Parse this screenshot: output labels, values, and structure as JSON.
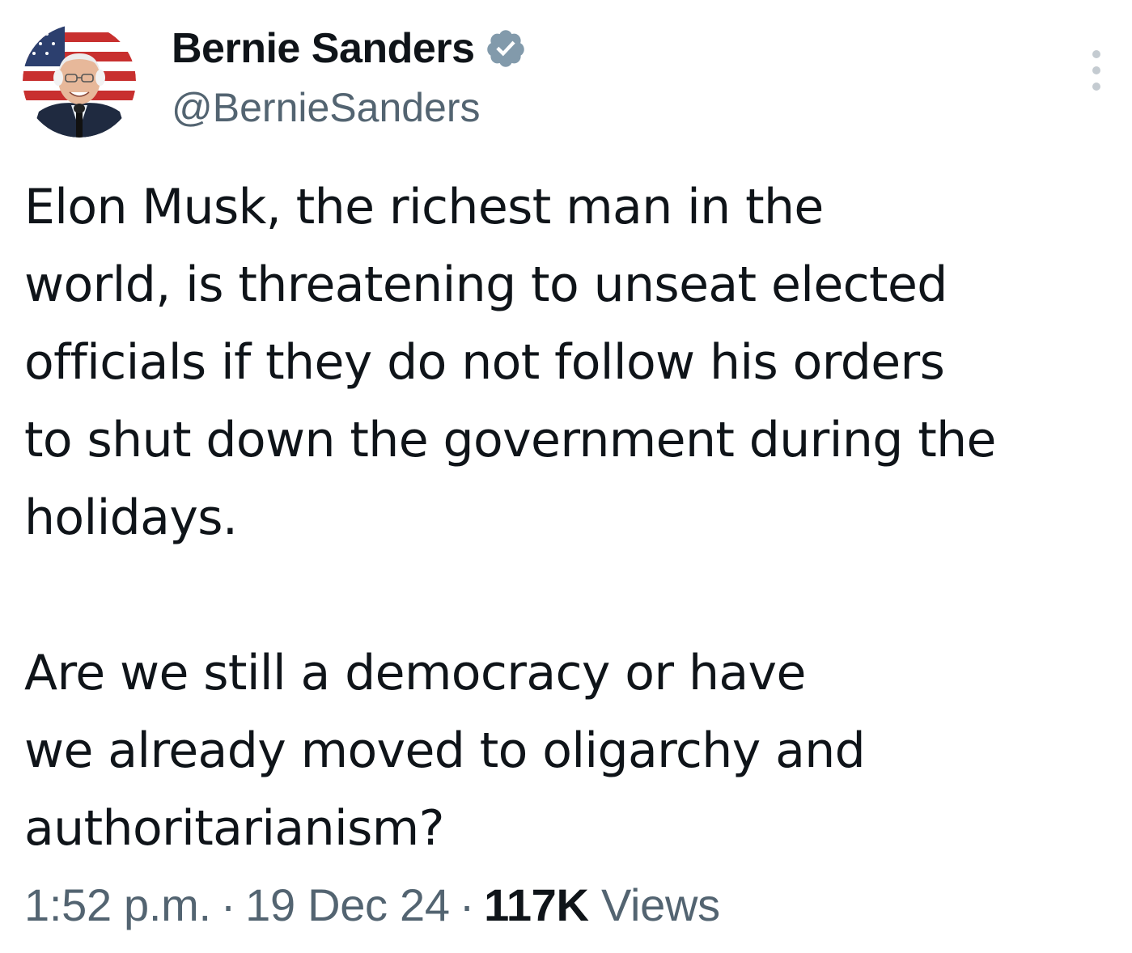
{
  "author": {
    "display_name": "Bernie Sanders",
    "handle": "@BernieSanders",
    "verified_icon": "verified-badge-icon",
    "avatar_icon": "avatar"
  },
  "more_icon": "more-options-icon",
  "tweet": {
    "paragraphs": [
      {
        "lines": [
          "Elon Musk, the richest man in the",
          "world, is threatening to unseat elected",
          "officials if they do not follow his orders",
          "to shut down the government during the",
          "holidays."
        ]
      },
      {
        "lines": [
          "Are we still a democracy or have",
          "we already moved to oligarchy and",
          "authoritarianism?"
        ]
      }
    ]
  },
  "meta": {
    "time": "1:52 p.m.",
    "separator": "·",
    "date": "19 Dec 24",
    "views_count": "117K",
    "views_label": "Views"
  },
  "colors": {
    "text": "#0f1419",
    "secondary": "#536471",
    "verified_badge": "#829aab"
  }
}
